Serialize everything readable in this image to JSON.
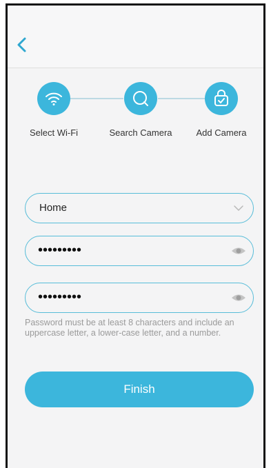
{
  "nav": {
    "back_icon": "chevron-left-icon"
  },
  "steps": [
    {
      "label": "Select Wi-Fi",
      "icon": "wifi-icon"
    },
    {
      "label": "Search Camera",
      "icon": "search-icon"
    },
    {
      "label": "Add Camera",
      "icon": "lock-bag-icon"
    }
  ],
  "form": {
    "network_value": "Home",
    "password_masked": "•••••••••",
    "confirm_masked": "•••••••••",
    "hint": "Password must be at least 8 characters and include an uppercase letter, a lower-case letter, and a number.",
    "finish_label": "Finish"
  },
  "colors": {
    "accent": "#3cb6dc",
    "border": "#56bcd8",
    "hint": "#9a9a9a"
  }
}
